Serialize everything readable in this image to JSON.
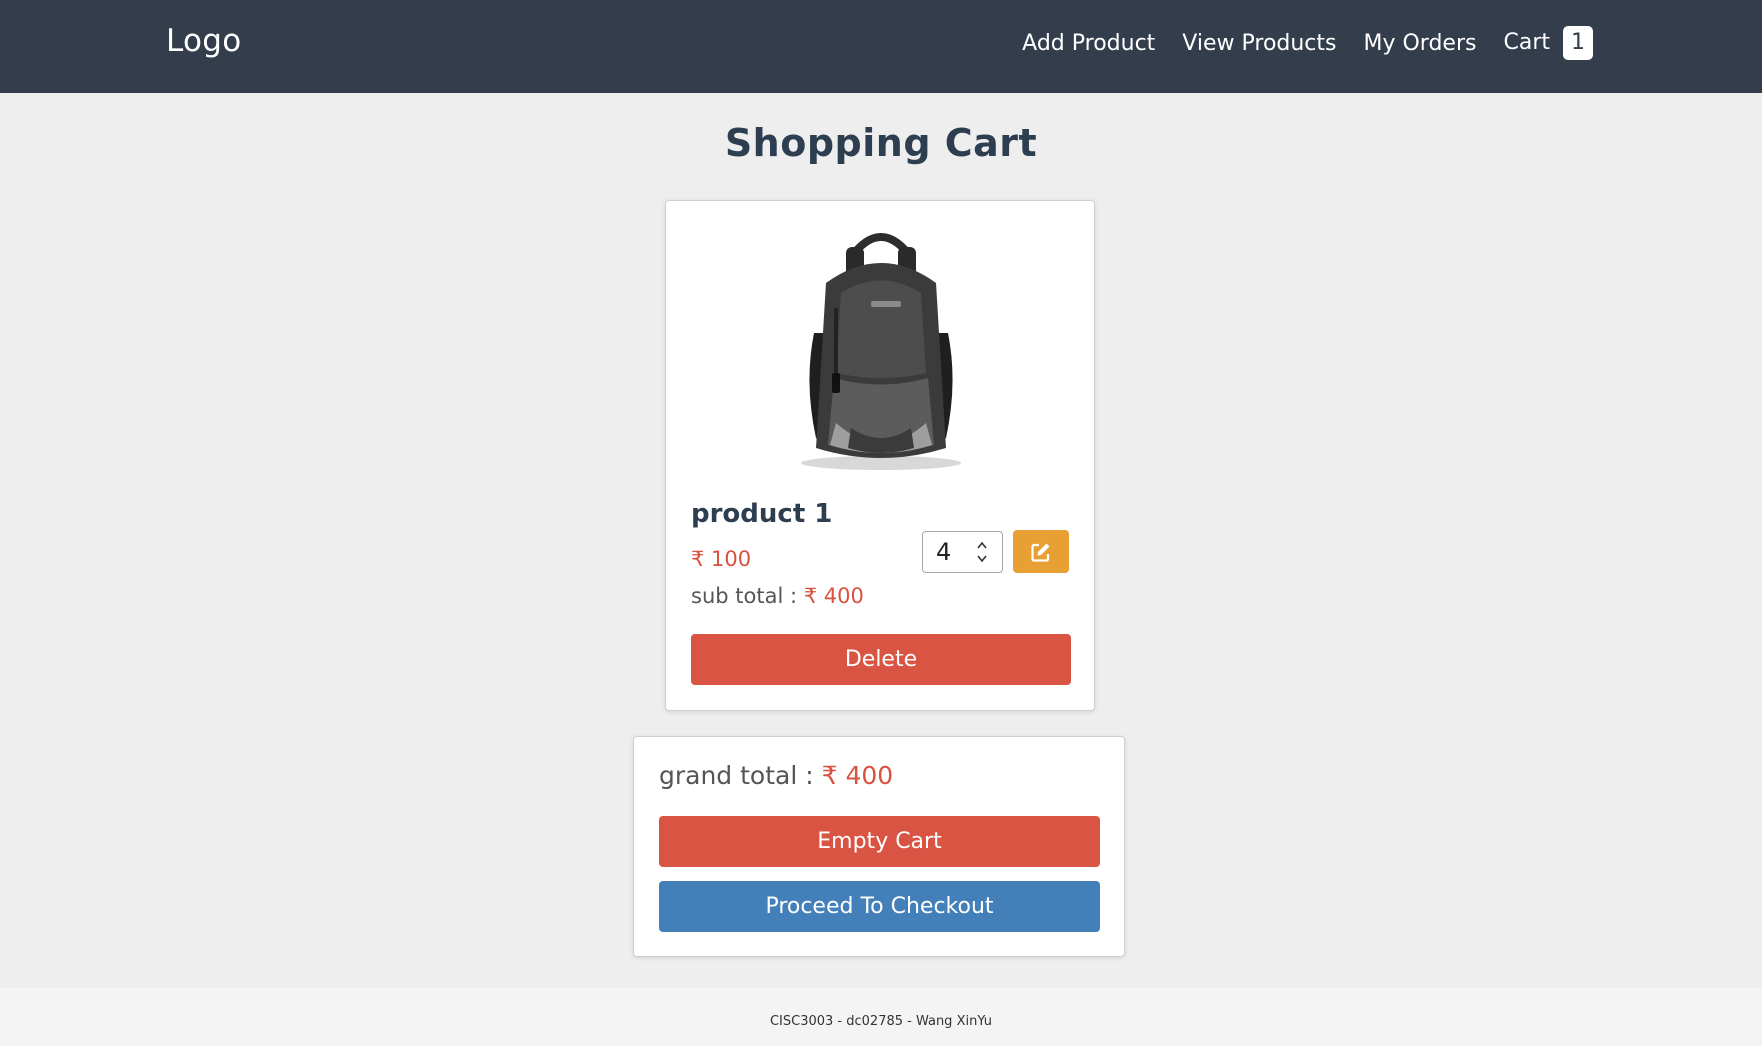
{
  "header": {
    "logo": "Logo",
    "nav": {
      "add_product": "Add Product",
      "view_products": "View Products",
      "my_orders": "My Orders",
      "cart": "Cart",
      "cart_count": "1"
    }
  },
  "page_title": "Shopping Cart",
  "cart_item": {
    "image_icon": "backpack-image",
    "name": "product 1",
    "price": "₹ 100",
    "subtotal_label": "sub total :",
    "subtotal_value": "₹ 400",
    "quantity": "4",
    "edit_icon": "edit-icon",
    "delete_label": "Delete"
  },
  "summary": {
    "grand_total_label": "grand total :",
    "grand_total_value": "₹ 400",
    "empty_cart_label": "Empty Cart",
    "checkout_label": "Proceed To Checkout"
  },
  "footer": {
    "text": "CISC3003 - dc02785 - Wang XinYu"
  },
  "colors": {
    "header_bg": "#333d4c",
    "accent_red": "#d95442",
    "price_red": "#d9513f",
    "edit_orange": "#e8a034",
    "checkout_blue": "#4380b9"
  }
}
